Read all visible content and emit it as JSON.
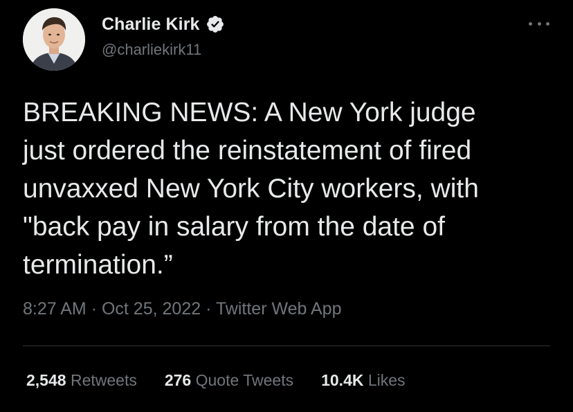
{
  "author": {
    "display_name": "Charlie Kirk",
    "handle": "@charliekirk11",
    "verified": true,
    "avatar_icon": "profile-photo"
  },
  "tweet": {
    "text": "BREAKING NEWS: A New York judge\njust ordered the reinstatement of fired\nunvaxxed New York City workers, with\n\"back pay in salary from the date of\ntermination.”",
    "time": "8:27 AM",
    "date": "Oct 25, 2022",
    "source": "Twitter Web App",
    "separator": "·"
  },
  "stats": {
    "retweets_value": "2,548",
    "retweets_label": "Retweets",
    "quotes_value": "276",
    "quotes_label": "Quote Tweets",
    "likes_value": "10.4K",
    "likes_label": "Likes"
  },
  "colors": {
    "background": "#000000",
    "primary_text": "#e7e9ea",
    "secondary_text": "#71767b",
    "divider": "#2f3336",
    "verified_badge": "#e7e9ea"
  },
  "icons": {
    "verified": "verified-badge-icon",
    "more": "more-dots-icon"
  }
}
